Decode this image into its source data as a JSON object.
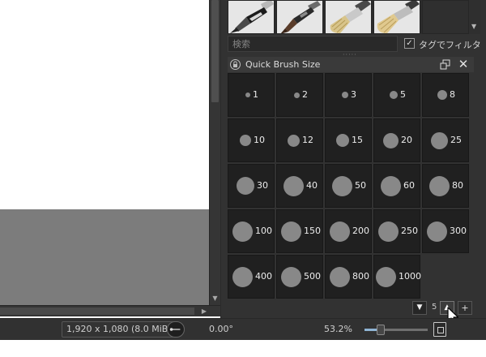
{
  "search": {
    "placeholder": "検索"
  },
  "filter": {
    "label": "タグでフィルタ",
    "checked": true,
    "check_glyph": "✓"
  },
  "docker": {
    "title": "Quick Brush Size"
  },
  "brushes": [
    {
      "label": "1",
      "size": 1
    },
    {
      "label": "2",
      "size": 2
    },
    {
      "label": "3",
      "size": 3
    },
    {
      "label": "5",
      "size": 5
    },
    {
      "label": "8",
      "size": 8
    },
    {
      "label": "10",
      "size": 10
    },
    {
      "label": "12",
      "size": 12
    },
    {
      "label": "15",
      "size": 15
    },
    {
      "label": "20",
      "size": 20
    },
    {
      "label": "25",
      "size": 25
    },
    {
      "label": "30",
      "size": 30
    },
    {
      "label": "40",
      "size": 40
    },
    {
      "label": "50",
      "size": 50
    },
    {
      "label": "60",
      "size": 60
    },
    {
      "label": "80",
      "size": 80
    },
    {
      "label": "100",
      "size": 100
    },
    {
      "label": "150",
      "size": 150
    },
    {
      "label": "200",
      "size": 200
    },
    {
      "label": "250",
      "size": 250
    },
    {
      "label": "300",
      "size": 300
    },
    {
      "label": "400",
      "size": 400
    },
    {
      "label": "500",
      "size": 500
    },
    {
      "label": "800",
      "size": 800
    },
    {
      "label": "1000",
      "size": 1000
    }
  ],
  "controls": {
    "down_glyph": "▼",
    "up_glyph": "▲",
    "value": "5",
    "add_glyph": "+"
  },
  "status": {
    "doc_size": "1,920 x 1,080 (8.0 MiB)",
    "rotation": "0.00°",
    "zoom": "53.2%",
    "zoom_level": 0.25
  },
  "glyphs": {
    "close": "✕",
    "scroll_down": "▼",
    "scroll_right": "▶"
  },
  "icons": [
    "lock-icon",
    "float-icon",
    "close-icon",
    "rotation-icon",
    "fit-page-icon",
    "cursor-icon",
    "brush-preset-icon"
  ],
  "colors": {
    "dock_bg": "#323232",
    "cell_bg": "#202020",
    "dot": "#888888",
    "canvas_gray": "#7c7c7c"
  }
}
